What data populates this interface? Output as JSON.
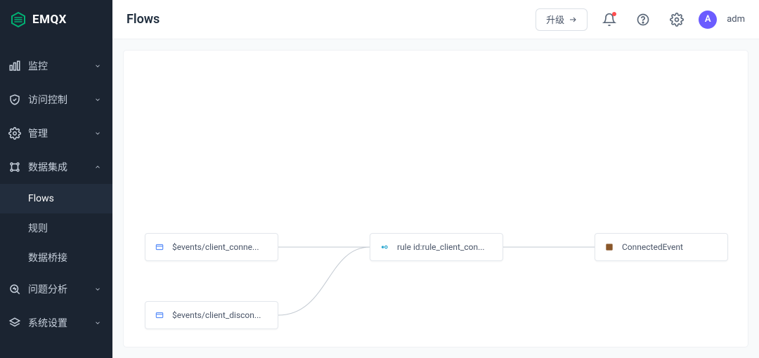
{
  "brand": {
    "name": "EMQX"
  },
  "header": {
    "title": "Flows",
    "upgrade_label": "升级",
    "user_initial": "A",
    "user_name": "adm"
  },
  "sidebar": {
    "groups": [
      {
        "label": "监控",
        "sub": []
      },
      {
        "label": "访问控制",
        "sub": []
      },
      {
        "label": "管理",
        "sub": []
      },
      {
        "label": "数据集成",
        "expanded": true,
        "sub": [
          {
            "label": "Flows",
            "active": true
          },
          {
            "label": "规则"
          },
          {
            "label": "数据桥接"
          }
        ]
      },
      {
        "label": "问题分析",
        "sub": []
      },
      {
        "label": "系统设置",
        "sub": []
      }
    ]
  },
  "flow": {
    "nodes": [
      {
        "id": "n1",
        "label": "$events/client_conne...",
        "type": "event"
      },
      {
        "id": "n2",
        "label": "$events/client_discon...",
        "type": "event"
      },
      {
        "id": "n3",
        "label": "rule id:rule_client_con...",
        "type": "rule"
      },
      {
        "id": "n4",
        "label": "ConnectedEvent",
        "type": "sink"
      }
    ],
    "edges": [
      {
        "from": "n1",
        "to": "n3"
      },
      {
        "from": "n2",
        "to": "n3"
      },
      {
        "from": "n3",
        "to": "n4"
      }
    ]
  }
}
